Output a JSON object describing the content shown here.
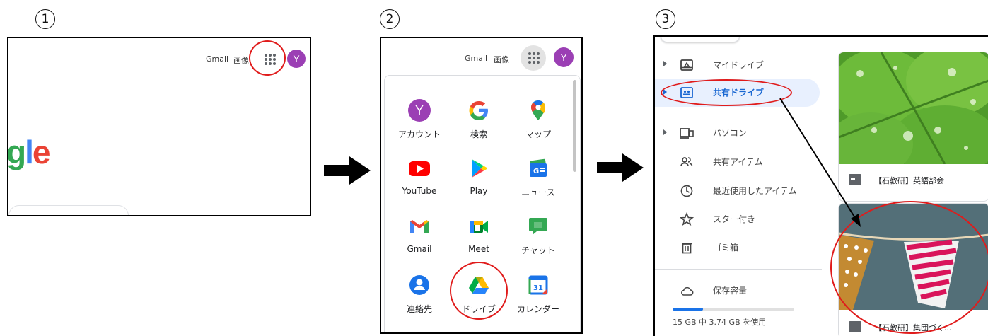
{
  "steps": [
    "①",
    "②",
    "③"
  ],
  "panel1": {
    "links": [
      "Gmail",
      "画像"
    ],
    "avatar": "Y",
    "logo_fragment": "gle"
  },
  "panel2": {
    "links": [
      "Gmail",
      "画像"
    ],
    "avatar": "Y",
    "apps": [
      {
        "label": "アカウント",
        "icon": "account-icon"
      },
      {
        "label": "検索",
        "icon": "google-search-icon"
      },
      {
        "label": "マップ",
        "icon": "maps-icon"
      },
      {
        "label": "YouTube",
        "icon": "youtube-icon"
      },
      {
        "label": "Play",
        "icon": "play-icon"
      },
      {
        "label": "ニュース",
        "icon": "news-icon"
      },
      {
        "label": "Gmail",
        "icon": "gmail-icon"
      },
      {
        "label": "Meet",
        "icon": "meet-icon"
      },
      {
        "label": "チャット",
        "icon": "chat-icon"
      },
      {
        "label": "連絡先",
        "icon": "contacts-icon"
      },
      {
        "label": "ドライブ",
        "icon": "drive-icon"
      },
      {
        "label": "カレンダー",
        "icon": "calendar-icon"
      }
    ],
    "account_letter": "Y",
    "calendar_day": "31"
  },
  "panel3": {
    "nav": [
      {
        "label": "マイドライブ",
        "icon": "my-drive-icon"
      },
      {
        "label": "共有ドライブ",
        "icon": "shared-drives-icon"
      },
      {
        "label": "パソコン",
        "icon": "computers-icon"
      },
      {
        "label": "共有アイテム",
        "icon": "shared-with-me-icon"
      },
      {
        "label": "最近使用したアイテム",
        "icon": "recent-icon"
      },
      {
        "label": "スター付き",
        "icon": "starred-icon"
      },
      {
        "label": "ゴミ箱",
        "icon": "trash-icon"
      },
      {
        "label": "保存容量",
        "icon": "cloud-icon"
      }
    ],
    "storage_text": "15 GB 中 3.74 GB を使用",
    "storage_fraction": 0.25,
    "cards": [
      {
        "title": "【石教研】英語部会"
      },
      {
        "title": "【石教研】集団づく..."
      }
    ]
  },
  "colors": {
    "accent": "#e01b1b",
    "avatar": "#9b3fb4",
    "selected": "#e8f0fe"
  }
}
